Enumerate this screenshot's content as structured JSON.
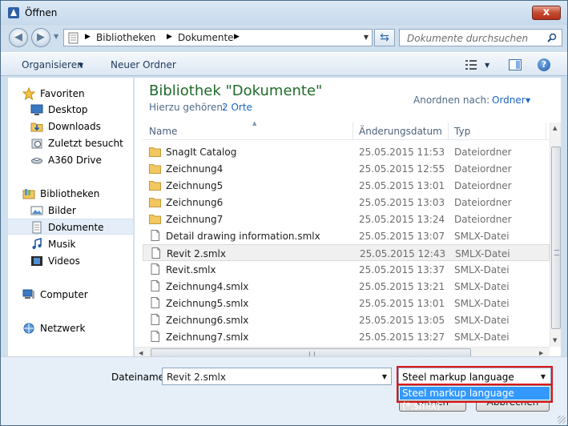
{
  "window": {
    "title": "Öffnen",
    "close_label": "x"
  },
  "address": {
    "breadcrumbs": [
      "Bibliotheken",
      "Dokumente"
    ],
    "search_placeholder": "Dokumente durchsuchen"
  },
  "toolbar": {
    "organize": "Organisieren",
    "new_folder": "Neuer Ordner"
  },
  "nav": {
    "favorites": "Favoriten",
    "desktop": "Desktop",
    "downloads": "Downloads",
    "recent": "Zuletzt besucht",
    "a360": "A360 Drive",
    "libraries": "Bibliotheken",
    "pictures": "Bilder",
    "documents": "Dokumente",
    "music": "Musik",
    "videos": "Videos",
    "computer": "Computer",
    "network": "Netzwerk"
  },
  "library": {
    "title": "Bibliothek \"Dokumente\"",
    "includes_label": "Hierzu gehören:",
    "includes_link": "2 Orte",
    "arrange_label": "Anordnen nach:",
    "arrange_value": "Ordner"
  },
  "columns": {
    "name": "Name",
    "date": "Änderungsdatum",
    "type": "Typ"
  },
  "files": [
    {
      "icon": "folder-icon",
      "name": "SnagIt Catalog",
      "date": "25.05.2015 11:53",
      "type": "Dateiordner"
    },
    {
      "icon": "folder-icon",
      "name": "Zeichnung4",
      "date": "25.05.2015 12:55",
      "type": "Dateiordner"
    },
    {
      "icon": "folder-icon",
      "name": "Zeichnung5",
      "date": "25.05.2015 13:01",
      "type": "Dateiordner"
    },
    {
      "icon": "folder-icon",
      "name": "Zeichnung6",
      "date": "25.05.2015 13:03",
      "type": "Dateiordner"
    },
    {
      "icon": "folder-icon",
      "name": "Zeichnung7",
      "date": "25.05.2015 13:24",
      "type": "Dateiordner"
    },
    {
      "icon": "file-icon",
      "name": "Detail drawing information.smlx",
      "date": "25.05.2015 13:07",
      "type": "SMLX-Datei"
    },
    {
      "icon": "file-icon",
      "name": "Revit 2.smlx",
      "date": "25.05.2015 12:43",
      "type": "SMLX-Datei",
      "selected": true
    },
    {
      "icon": "file-icon",
      "name": "Revit.smlx",
      "date": "25.05.2015 13:37",
      "type": "SMLX-Datei"
    },
    {
      "icon": "file-icon",
      "name": "Zeichnung4.smlx",
      "date": "25.05.2015 13:21",
      "type": "SMLX-Datei"
    },
    {
      "icon": "file-icon",
      "name": "Zeichnung5.smlx",
      "date": "25.05.2015 13:01",
      "type": "SMLX-Datei"
    },
    {
      "icon": "file-icon",
      "name": "Zeichnung6.smlx",
      "date": "25.05.2015 13:05",
      "type": "SMLX-Datei"
    },
    {
      "icon": "file-icon",
      "name": "Zeichnung7.smlx",
      "date": "25.05.2015 13:27",
      "type": "SMLX-Datei"
    }
  ],
  "footer": {
    "filename_label": "Dateiname:",
    "filename_value": "Revit 2.smlx",
    "filetype_value": "Steel markup language (*.smlx)",
    "filetype_option": "Steel markup language (*.smlx)",
    "open_button": "Öffnen",
    "cancel_button": "Abbrechen"
  },
  "colors": {
    "highlight": "#3399ff",
    "callout_outline": "#e0151a",
    "library_title": "#1f6a2a",
    "link": "#1a64c2"
  }
}
